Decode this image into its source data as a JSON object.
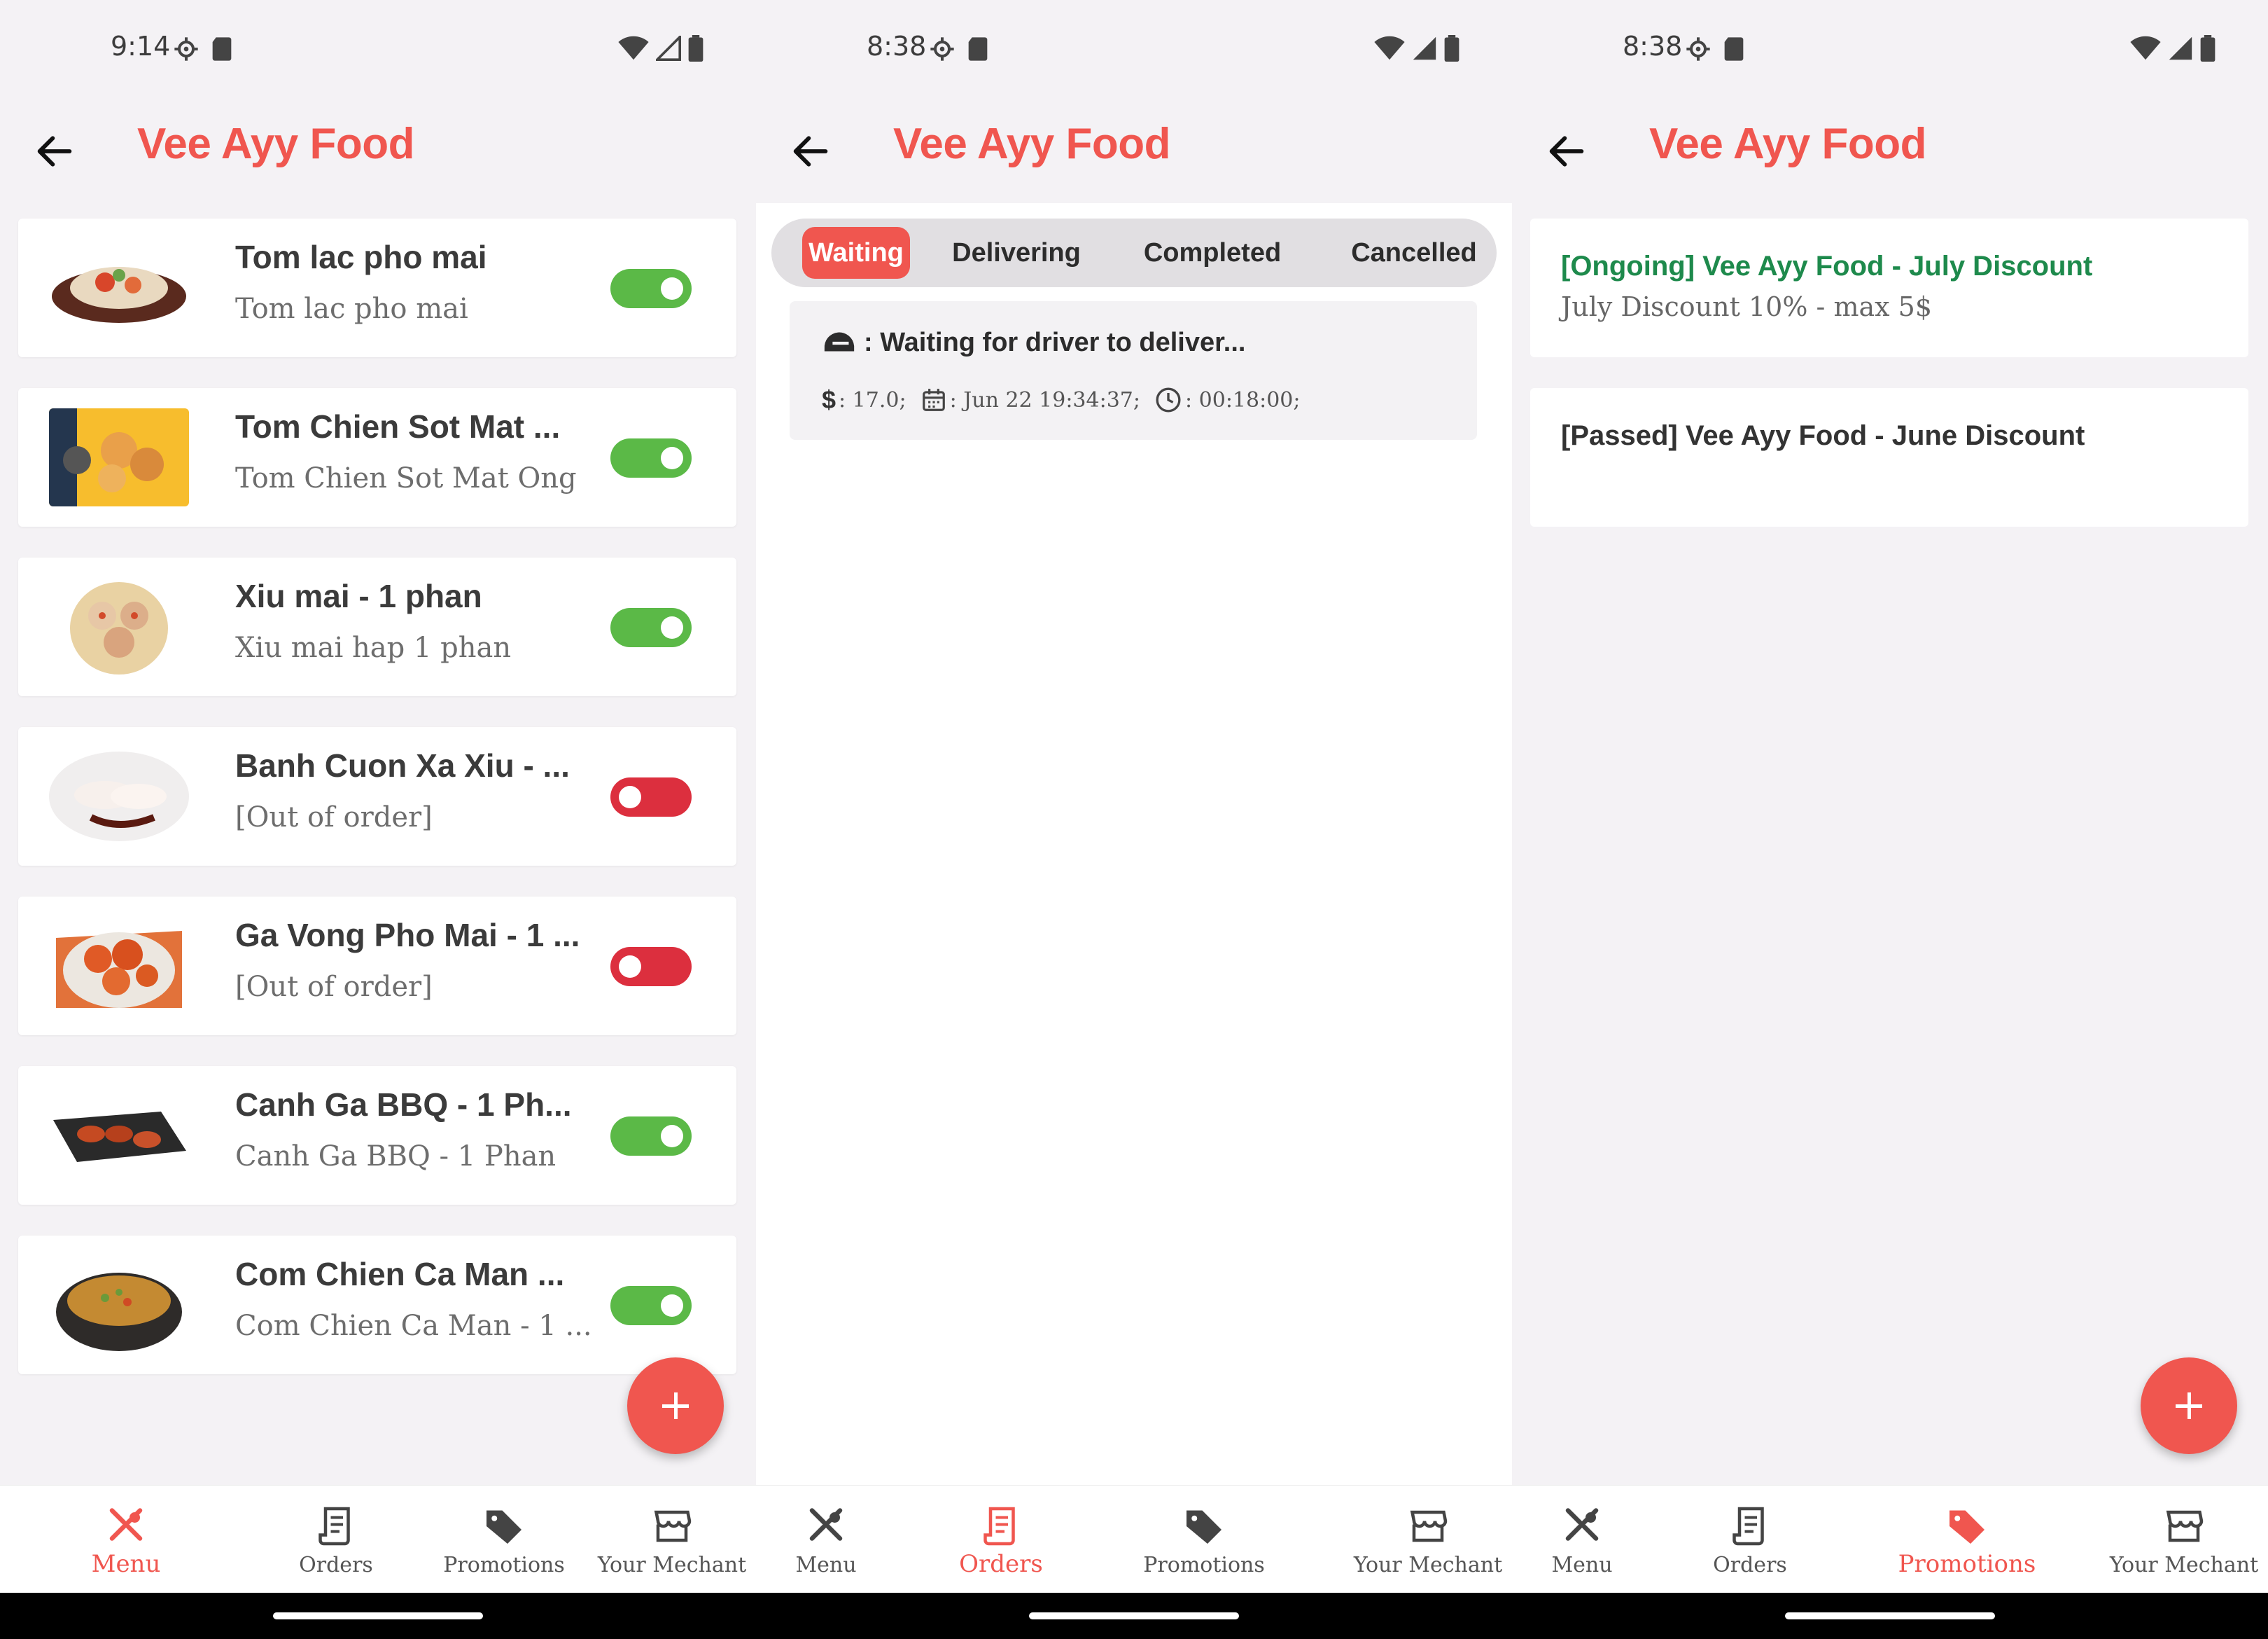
{
  "status_bars": [
    {
      "time": "9:14"
    },
    {
      "time": "8:38"
    },
    {
      "time": "8:38"
    }
  ],
  "app": {
    "title": "Vee Ayy Food"
  },
  "menu": {
    "items": [
      {
        "name": "Tom lac pho mai",
        "desc": "Tom lac pho mai",
        "available": true
      },
      {
        "name": "Tom Chien Sot Mat ...",
        "desc": "Tom Chien Sot Mat Ong",
        "available": true
      },
      {
        "name": "Xiu mai - 1 phan",
        "desc": "Xiu mai hap 1 phan",
        "available": true
      },
      {
        "name": "Banh Cuon Xa Xiu - ...",
        "desc": "[Out of order]",
        "available": false
      },
      {
        "name": "Ga Vong Pho Mai - 1 ...",
        "desc": "[Out of order]",
        "available": false
      },
      {
        "name": "Canh Ga BBQ - 1 Ph...",
        "desc": "Canh Ga BBQ - 1 Phan",
        "available": true
      },
      {
        "name": "Com Chien Ca Man ...",
        "desc": "Com Chien Ca Man - 1 ...",
        "available": true
      }
    ]
  },
  "orders": {
    "tabs": [
      {
        "label": "Waiting",
        "active": true
      },
      {
        "label": "Delivering",
        "active": false
      },
      {
        "label": "Completed",
        "active": false
      },
      {
        "label": "Cancelled",
        "active": false
      }
    ],
    "card": {
      "status": ": Waiting for driver to deliver...",
      "price": ": 17.0;",
      "date": ": Jun 22 19:34:37;",
      "duration": ": 00:18:00;"
    }
  },
  "promotions": {
    "items": [
      {
        "title": "[Ongoing] Vee Ayy Food - July Discount",
        "desc": "July Discount 10% - max 5$",
        "state": "ongoing"
      },
      {
        "title": "[Passed] Vee Ayy Food - June Discount",
        "desc": "",
        "state": "passed"
      }
    ]
  },
  "nav": {
    "menu": "Menu",
    "orders": "Orders",
    "promotions": "Promotions",
    "merchant": "Your Mechant"
  },
  "colors": {
    "accent": "#f0564f",
    "toggle_on": "#5bb947",
    "toggle_off": "#dc2f3e",
    "ongoing": "#1e8a4c"
  }
}
